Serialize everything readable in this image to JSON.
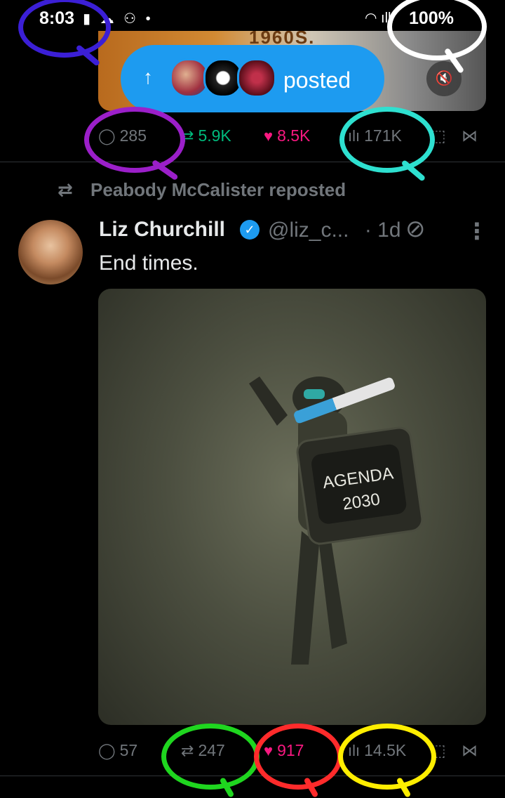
{
  "status_bar": {
    "time": "8:03",
    "battery": "100%",
    "left_icons": "▮ ☁ ⚇ •",
    "right_icons": "◠ ıll"
  },
  "prev_tweet": {
    "media_text": "1960S.",
    "posted_label": "posted",
    "arrow": "↑",
    "mute_icon": "🔇",
    "metrics": {
      "replies": "285",
      "reposts": "5.9K",
      "likes": "8.5K",
      "views": "171K"
    }
  },
  "tweet": {
    "repost_by": "Peabody McCalister reposted",
    "author_name": "Liz Churchill",
    "verified_mark": "✓",
    "handle": "@liz_c...",
    "age": "· 1d",
    "text": "End times.",
    "image_text_line1": "AGENDA",
    "image_text_line2": "2030",
    "metrics": {
      "replies": "57",
      "reposts": "247",
      "likes": "917",
      "views": "14.5K"
    }
  },
  "icons": {
    "reply": "◯",
    "repost": "⇄",
    "like": "♥",
    "views": "ılı",
    "bookmark": "⬚",
    "share": "⋈",
    "grok": "⊘",
    "more": "⋮"
  },
  "annotation_colors": {
    "purple_blue": "#3b1fd6",
    "white": "#ffffff",
    "magenta": "#9b1fc9",
    "cyan": "#2ee0d0",
    "green": "#1fd61f",
    "red": "#ff2b2b",
    "yellow": "#ffee00"
  }
}
